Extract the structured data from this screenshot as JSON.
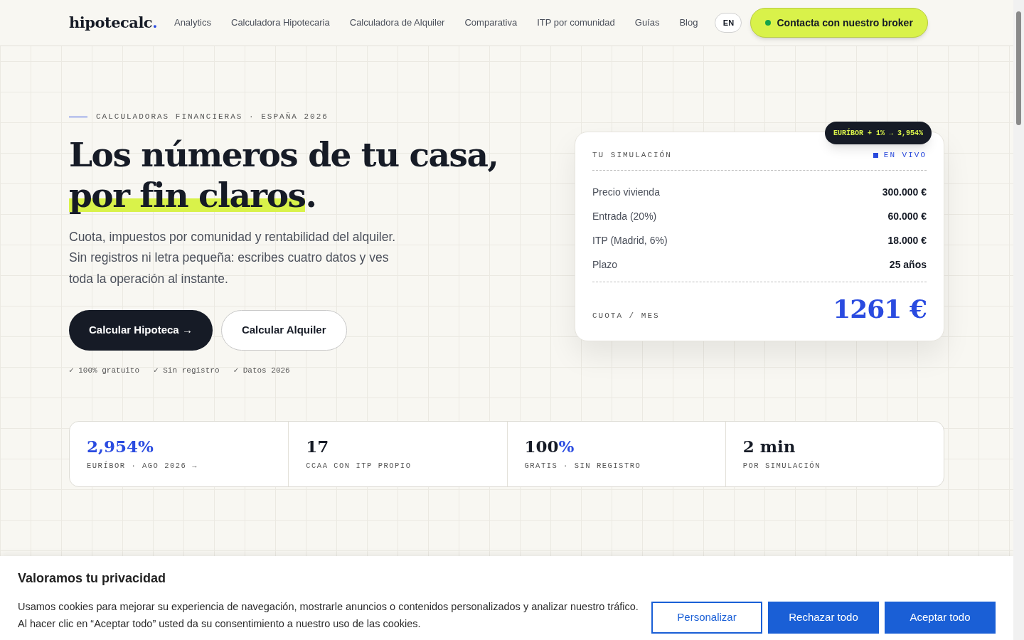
{
  "nav": {
    "logo": "hipotecalc",
    "logo_dot": ".",
    "links": [
      "Analytics",
      "Calculadora Hipotecaria",
      "Calculadora de Alquiler",
      "Comparativa",
      "ITP por comunidad",
      "Guías",
      "Blog"
    ],
    "language": "EN",
    "cta": "Contacta con nuestro broker"
  },
  "hero": {
    "eyebrow": "CALCULADORAS FINANCIERAS · ESPAÑA 2026",
    "title_line1": "Los números de tu casa,",
    "title_highlight": "por fin claros",
    "title_end": ".",
    "lead": [
      "Cuota, impuestos por comunidad y rentabilidad del alquiler.",
      "Sin registros ni letra pequeña: escribes cuatro datos y ves",
      "toda la operación al instante."
    ],
    "buttons": [
      {
        "label": "Calcular Hipoteca →",
        "kind": "primary"
      },
      {
        "label": "Calcular Alquiler",
        "kind": "secondary"
      }
    ],
    "checks": [
      "✓ 100% gratuito",
      "✓ Sin registro",
      "✓ Datos 2026"
    ]
  },
  "simulation": {
    "badge": "EURÍBOR + 1% → 3,954%",
    "title": "TU SIMULACIÓN",
    "live": "EN VIVO",
    "rows": [
      {
        "label": "Precio vivienda",
        "value": "300.000 €"
      },
      {
        "label": "Entrada (20%)",
        "value": "60.000 €"
      },
      {
        "label": "ITP (Madrid, 6%)",
        "value": "18.000 €"
      },
      {
        "label": "Plazo",
        "value": "25 años"
      }
    ],
    "total_label": "CUOTA / MES",
    "total": "1261 €"
  },
  "stats": [
    {
      "parts": [
        {
          "text": "2,954%",
          "accent": true
        }
      ],
      "caption": "EURÍBOR · AGO 2026 →"
    },
    {
      "parts": [
        {
          "text": "17",
          "accent": false
        }
      ],
      "caption": "CCAA CON ITP PROPIO"
    },
    {
      "parts": [
        {
          "text": "100",
          "accent": false
        },
        {
          "text": "%",
          "accent": true
        }
      ],
      "caption": "GRATIS · SIN REGISTRO"
    },
    {
      "parts": [
        {
          "text": "2 min",
          "accent": false
        }
      ],
      "caption": "POR SIMULACIÓN"
    }
  ],
  "cookie": {
    "title": "Valoramos tu privacidad",
    "text": [
      "Usamos cookies para mejorar su experiencia de navegación, mostrarle anuncios o contenidos personalizados y analizar nuestro tráfico.",
      "Al hacer clic en “Aceptar todo” usted da su consentimiento a nuestro uso de las cookies."
    ],
    "buttons": [
      {
        "label": "Personalizar",
        "kind": "outline"
      },
      {
        "label": "Rechazar todo",
        "kind": "solid"
      },
      {
        "label": "Aceptar todo",
        "kind": "solid"
      }
    ]
  }
}
